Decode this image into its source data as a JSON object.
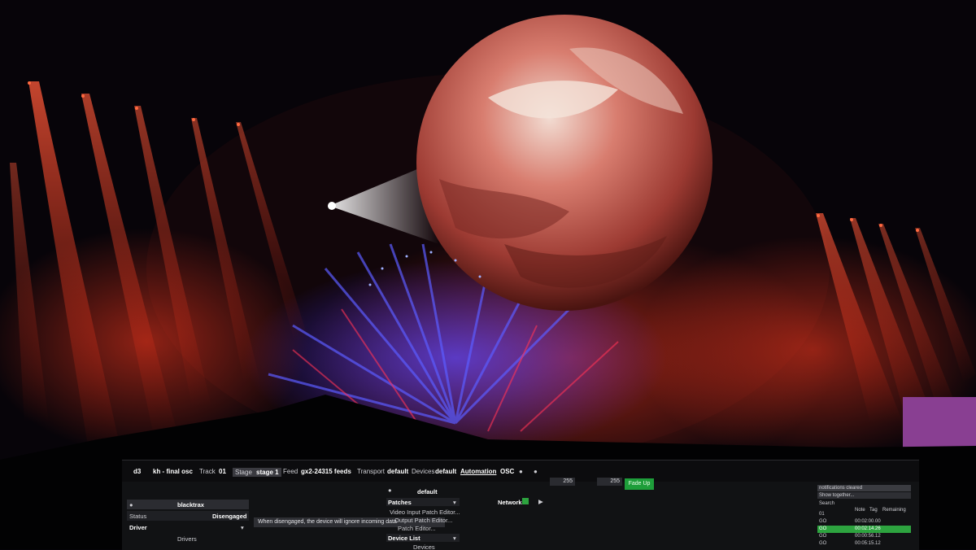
{
  "scene": {
    "sky": "#050308",
    "red_beam": "#ff3a1f",
    "blue_beam": "#3b4dff",
    "planet_base": "#b8453c",
    "planet_light": "#f0d6cc"
  },
  "ui": {
    "topbar": {
      "app": "d3",
      "project": "kh - final osc",
      "track_label": "Track",
      "track_value": "01",
      "stage_label": "Stage",
      "stage_value": "stage 1",
      "feed_label": "Feed",
      "feed_value": "gx2-24315 feeds",
      "transport_label": "Transport",
      "transport_value": "default",
      "devices_label": "Devices",
      "devices_value": "default",
      "automation": "Automation",
      "osc": "OSC",
      "field1": "255",
      "field2": "255",
      "fade_up": "Fade Up"
    },
    "left": {
      "device_name": "blacktrax",
      "status_label": "Status",
      "status_value": "Disengaged",
      "driver_label": "Driver",
      "drivers_label": "Drivers",
      "tooltip": "When disengaged, the device will ignore incoming data"
    },
    "middle": {
      "default_label": "default",
      "patches_label": "Patches",
      "patch_items": [
        "Video Input Patch Editor...",
        "Output Patch Editor...",
        "Patch Editor..."
      ],
      "device_list_label": "Device List",
      "devices_label": "Devices"
    },
    "network": {
      "label": "Network"
    },
    "right": {
      "header1": "notifications cleared",
      "header2": "Show together...",
      "search_label": "Search",
      "col_note": "Note",
      "col_tag": "Tag",
      "col_remaining": "Remaining",
      "rows": [
        {
          "a": "01",
          "b": "",
          "c": ""
        },
        {
          "a": "GO",
          "b": "",
          "c": "00:02:00.00"
        },
        {
          "a": "GO",
          "b": "",
          "c": "00:02:14.26"
        },
        {
          "a": "GO",
          "b": "",
          "c": "00:00:56.12"
        },
        {
          "a": "GO",
          "b": "",
          "c": "00:05:15.12"
        }
      ]
    }
  }
}
